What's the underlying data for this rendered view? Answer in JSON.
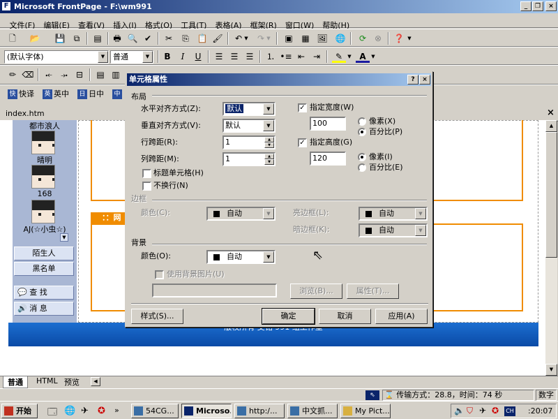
{
  "window": {
    "title": "Microsoft FrontPage - F:\\wm991"
  },
  "menu": [
    "文件(F)",
    "编辑(E)",
    "查看(V)",
    "插入(I)",
    "格式(O)",
    "工具(T)",
    "表格(A)",
    "框架(R)",
    "窗口(W)",
    "帮助(H)"
  ],
  "format_toolbar": {
    "font": "(默认字体)",
    "style": "普通",
    "bold": "B",
    "italic": "I",
    "underline": "U"
  },
  "ime_toolbar": {
    "items": [
      {
        "icon": "快",
        "label": "快译"
      },
      {
        "icon": "英",
        "label": "英中"
      },
      {
        "icon": "日",
        "label": "日中"
      },
      {
        "icon": "中",
        "label": ""
      }
    ]
  },
  "document": {
    "tab": "index.htm",
    "orange_label": "：：网"
  },
  "friends_panel": {
    "friends": [
      "都市浪人",
      "晴明",
      "168",
      "AJ(☆小虫☆)"
    ],
    "buttons": [
      "陌生人",
      "黑名单"
    ],
    "tools": [
      {
        "icon": "search-icon",
        "label": "查 找"
      },
      {
        "icon": "message-icon",
        "label": "消 息"
      }
    ]
  },
  "footer_text": "版权所有  艾铭 991 组工作室",
  "dialog": {
    "title": "单元格属性",
    "help": "?",
    "close": "×",
    "layout": {
      "group": "布局",
      "halign_label": "水平对齐方式(Z):",
      "halign_value": "默认",
      "valign_label": "垂直对齐方式(V):",
      "valign_value": "默认",
      "rowspan_label": "行跨距(R):",
      "rowspan_value": "1",
      "colspan_label": "列跨距(M):",
      "colspan_value": "1",
      "header_cell_label": "标题单元格(H)",
      "no_wrap_label": "不换行(N)",
      "width_label": "指定宽度(W)",
      "width_checked": true,
      "width_value": "100",
      "width_px": "像素(X)",
      "width_pct": "百分比(P)",
      "width_unit": "pct",
      "height_label": "指定高度(G)",
      "height_checked": true,
      "height_value": "120",
      "height_px": "像素(I)",
      "height_pct": "百分比(E)",
      "height_unit": "px"
    },
    "borders": {
      "group": "边框",
      "color_label": "颜色(C):",
      "color_value": "自动",
      "light_label": "亮边框(L):",
      "light_value": "自动",
      "dark_label": "暗边框(K):",
      "dark_value": "自动"
    },
    "background": {
      "group": "背景",
      "color_label": "颜色(O):",
      "color_value": "自动",
      "use_image_label": "使用背景图片(U)",
      "browse_label": "浏览(B)...",
      "properties_label": "属性(T)..."
    },
    "buttons": {
      "style": "样式(S)...",
      "ok": "确定",
      "cancel": "取消",
      "apply": "应用(A)"
    }
  },
  "view_tabs": [
    "普通",
    "HTML",
    "预览"
  ],
  "status_bar": {
    "transfer": "传输方式：28.8，时间：74 秒",
    "mode": "数字"
  },
  "taskbar": {
    "start": "开始",
    "tasks": [
      "54CG...",
      "Microso...",
      "http:/...",
      "中文抓...",
      "My Pict..."
    ],
    "tray_lang": "CH",
    "clock": ":20:07"
  },
  "colors": {
    "title_start": "#0a246a",
    "title_end": "#a6caf0",
    "accent_orange": "#f08c00",
    "banner_blue": "#1c6ed0",
    "panel_blue": "#a9b7d4"
  }
}
